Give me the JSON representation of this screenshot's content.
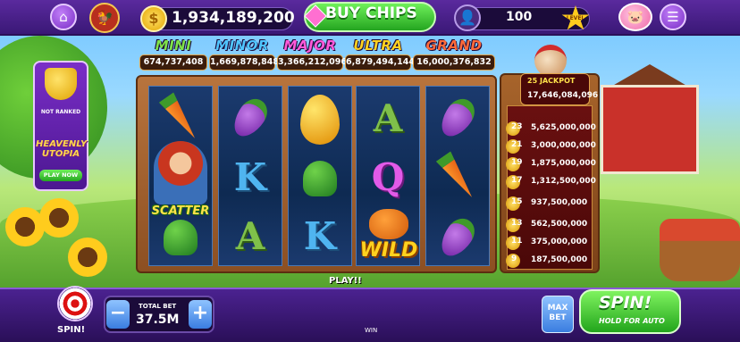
{
  "header": {
    "coins": "1,934,189,200",
    "coin_symbol": "$",
    "buy_label": "BUY CHIPS",
    "level_value": "100",
    "level_label": "LEVEL"
  },
  "jackpots": [
    {
      "label": "MINI",
      "value": "674,737,408",
      "color": "#7ee34a"
    },
    {
      "label": "MINOR",
      "value": "1,669,878,848",
      "color": "#4fc6ff"
    },
    {
      "label": "MAJOR",
      "value": "3,366,212,096",
      "color": "#ff5ad9"
    },
    {
      "label": "ULTRA",
      "value": "6,879,494,144",
      "color": "#ffd21f"
    },
    {
      "label": "GRAND",
      "value": "16,000,376,832",
      "color": "#ff6a3a"
    }
  ],
  "promo": {
    "rank_label": "NOT RANKED",
    "game_title": "HEAVENLY UTOPIA",
    "play_label": "PLAY NOW"
  },
  "reels": {
    "symbols": [
      [
        "carrot",
        "farmer-scatter",
        "broccoli"
      ],
      [
        "eggplant",
        "K",
        "A"
      ],
      [
        "golden-egg",
        "broccoli",
        "K"
      ],
      [
        "A",
        "Q",
        "pumpkin-wild"
      ],
      [
        "eggplant",
        "carrot",
        "eggplant"
      ]
    ],
    "scatter_label": "SCATTER",
    "wild_label": "WILD"
  },
  "side_panel": {
    "jackpot_count": "25",
    "jackpot_label": "JACKPOT",
    "jackpot_value": "17,646,084,096",
    "payouts": [
      {
        "count": "23",
        "value": "5,625,000,000"
      },
      {
        "count": "21",
        "value": "3,000,000,000"
      },
      {
        "count": "19",
        "value": "1,875,000,000"
      },
      {
        "count": "17",
        "value": "1,312,500,000"
      },
      {
        "count": "15",
        "value": "937,500,000"
      },
      {
        "count": "13",
        "value": "562,500,000"
      },
      {
        "count": "11",
        "value": "375,000,000"
      },
      {
        "count": "9",
        "value": "187,500,000"
      }
    ]
  },
  "status": {
    "play_text": "PLAY!!"
  },
  "footer": {
    "spin_target_label": "SPIN!",
    "total_bet_label": "TOTAL BET",
    "total_bet_value": "37.5M",
    "minus_label": "−",
    "plus_label": "+",
    "win_label": "WIN",
    "max_bet_label": "MAX BET",
    "spin_label": "SPIN!",
    "spin_sub_label": "HOLD FOR AUTO"
  },
  "icons": {
    "home": "home-icon",
    "menu": "menu-icon",
    "piggy_bank": "piggy-bank-icon",
    "user": "user-icon"
  }
}
